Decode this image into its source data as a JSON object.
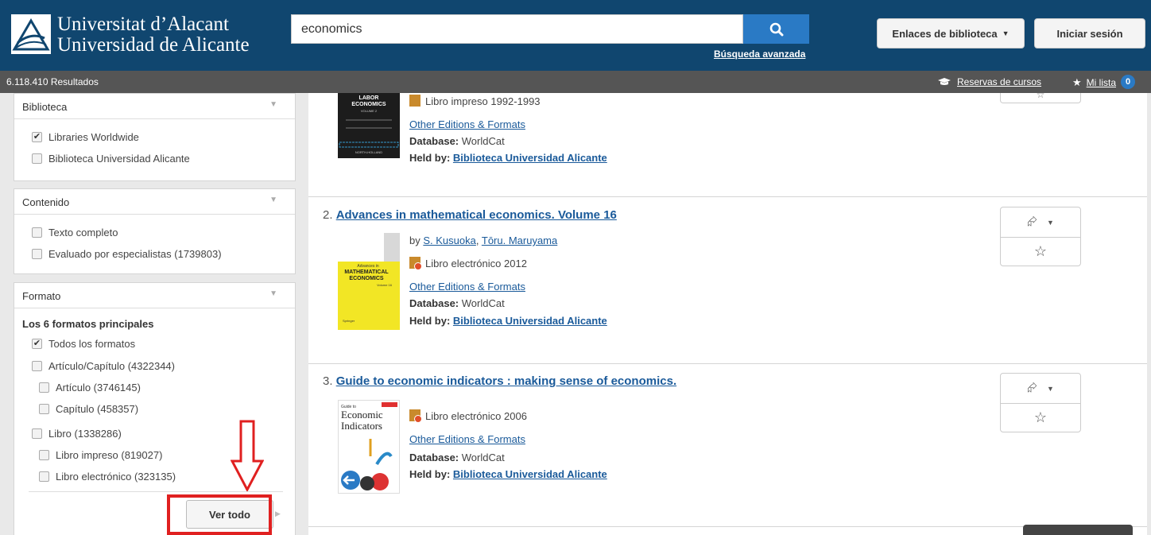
{
  "header": {
    "logo_line1": "Universitat d’Alacant",
    "logo_line2": "Universidad de Alicante",
    "search_value": "economics",
    "advanced_search": "Búsqueda avanzada",
    "library_links": "Enlaces de biblioteca",
    "login": "Iniciar sesión"
  },
  "subbar": {
    "results": "6.118.410 Resultados",
    "course_reserves": "Reservas de cursos",
    "my_list": "Mi lista",
    "my_list_count": "0"
  },
  "facets": {
    "biblioteca": {
      "title": "Biblioteca",
      "items": [
        {
          "label": "Libraries Worldwide",
          "checked": true
        },
        {
          "label": "Biblioteca Universidad Alicante",
          "checked": false
        }
      ]
    },
    "contenido": {
      "title": "Contenido",
      "items": [
        {
          "label": "Texto completo",
          "checked": false
        },
        {
          "label": "Evaluado por especialistas (1739803)",
          "checked": false
        }
      ]
    },
    "formato": {
      "title": "Formato",
      "group_label": "Los 6 formatos principales",
      "items": [
        {
          "label": "Todos los formatos",
          "checked": true
        },
        {
          "label": "Artículo/Capítulo (4322344)",
          "checked": false
        },
        {
          "label": "Artículo (3746145)",
          "checked": false
        },
        {
          "label": "Capítulo (458357)",
          "checked": false
        },
        {
          "label": "Libro (1338286)",
          "checked": false
        },
        {
          "label": "Libro impreso (819027)",
          "checked": false
        },
        {
          "label": "Libro electrónico (323135)",
          "checked": false
        }
      ],
      "see_all": "Ver todo"
    }
  },
  "results": [
    {
      "format": "Libro impreso 1992-1993",
      "editions": "Other Editions & Formats",
      "database_label": "Database:",
      "database": "WorldCat",
      "held_label": "Held by:",
      "held_by": "Biblioteca Universidad Alicante",
      "cover_text": [
        "LABOR",
        "ECONOMICS",
        "VOLUME 2",
        "NORTH-HOLLAND"
      ]
    },
    {
      "number": "2.",
      "title": "Advances in mathematical economics. Volume 16",
      "by": "by",
      "authors": [
        "S. Kusuoka",
        "Tōru. Maruyama"
      ],
      "author_sep": ",",
      "format": "Libro electrónico 2012",
      "editions": "Other Editions & Formats",
      "database_label": "Database:",
      "database": "WorldCat",
      "held_label": "Held by:",
      "held_by": "Biblioteca Universidad Alicante",
      "cover_text": [
        "Advances in",
        "MATHEMATICAL",
        "ECONOMICS",
        "Volume 16",
        "Springer"
      ]
    },
    {
      "number": "3.",
      "title": "Guide to economic indicators : making sense of economics.",
      "format": "Libro electrónico 2006",
      "editions": "Other Editions & Formats",
      "database_label": "Database:",
      "database": "WorldCat",
      "held_label": "Held by:",
      "held_by": "Biblioteca Universidad Alicante",
      "cover_text": [
        "Guide to",
        "Economic",
        "Indicators"
      ]
    }
  ],
  "icons": {
    "share": "share-icon",
    "star": "star-icon",
    "search": "search-icon",
    "mortarboard": "mortarboard-icon"
  },
  "colors": {
    "header_bg": "#10466f",
    "search_button": "#2a7ac5",
    "link": "#1a5a9a",
    "annotation": "#e02020"
  }
}
